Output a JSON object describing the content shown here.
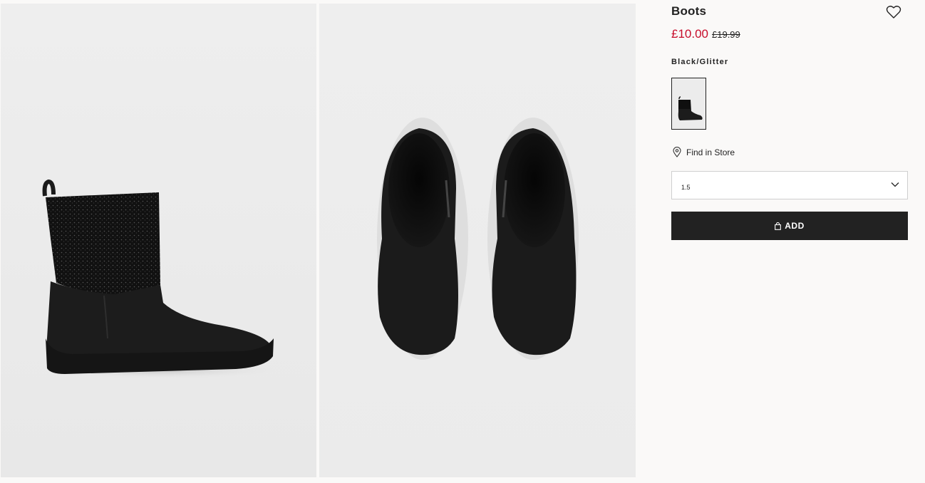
{
  "gallery": {
    "images": [
      {
        "icon": "boot-side-view-image"
      },
      {
        "icon": "boots-top-view-image"
      }
    ]
  },
  "product": {
    "title": "Boots",
    "price_current": "£10.00",
    "price_original": "£19.99",
    "color_name": "Black/Glitter",
    "find_in_store_label": "Find in Store",
    "selected_size": "1.5",
    "add_button_label": "ADD"
  },
  "colors": {
    "sale_price": "#c70d2b",
    "button_bg": "#222222",
    "page_bg": "#faf9f8"
  },
  "icons": {
    "wishlist": "heart-icon",
    "store": "location-pin-icon",
    "dropdown": "chevron-down-icon",
    "bag": "shopping-bag-icon"
  }
}
